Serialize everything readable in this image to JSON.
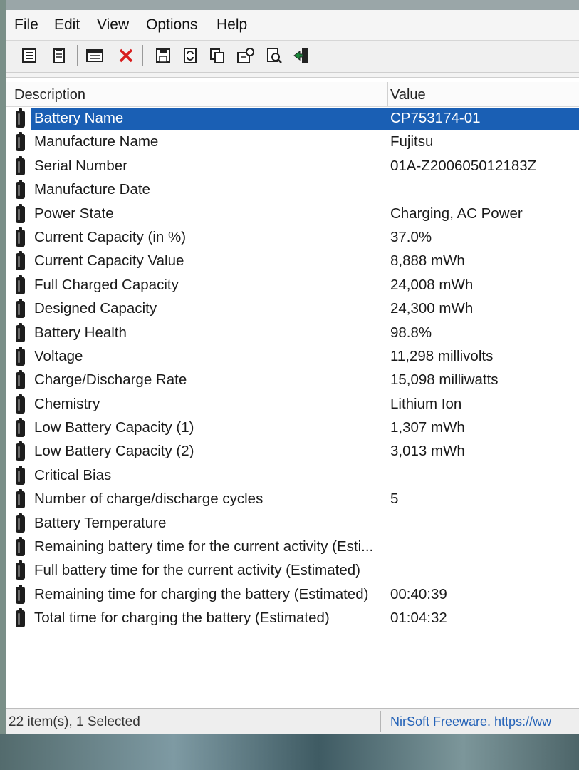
{
  "menu": [
    "File",
    "Edit",
    "View",
    "Options",
    "Help"
  ],
  "toolbar_icons": [
    "html-report-icon",
    "text-report-icon",
    "properties-icon",
    "delete-icon",
    "save-icon",
    "refresh-icon",
    "copy-icon",
    "options-icon",
    "find-icon",
    "exit-icon"
  ],
  "columns": {
    "description": "Description",
    "value": "Value"
  },
  "rows": [
    {
      "desc": "Battery Name",
      "val": "CP753174-01",
      "selected": true
    },
    {
      "desc": "Manufacture Name",
      "val": "Fujitsu"
    },
    {
      "desc": "Serial Number",
      "val": "01A-Z200605012183Z"
    },
    {
      "desc": "Manufacture Date",
      "val": ""
    },
    {
      "desc": "Power State",
      "val": "Charging, AC Power"
    },
    {
      "desc": "Current Capacity (in %)",
      "val": "37.0%"
    },
    {
      "desc": "Current Capacity Value",
      "val": "8,888 mWh"
    },
    {
      "desc": "Full Charged Capacity",
      "val": "24,008 mWh"
    },
    {
      "desc": "Designed Capacity",
      "val": "24,300 mWh"
    },
    {
      "desc": "Battery Health",
      "val": "98.8%"
    },
    {
      "desc": "Voltage",
      "val": "11,298 millivolts"
    },
    {
      "desc": "Charge/Discharge Rate",
      "val": "15,098 milliwatts"
    },
    {
      "desc": "Chemistry",
      "val": "Lithium Ion"
    },
    {
      "desc": "Low Battery Capacity (1)",
      "val": "1,307 mWh"
    },
    {
      "desc": "Low Battery Capacity (2)",
      "val": "3,013 mWh"
    },
    {
      "desc": "Critical Bias",
      "val": ""
    },
    {
      "desc": "Number of charge/discharge cycles",
      "val": "5"
    },
    {
      "desc": "Battery Temperature",
      "val": ""
    },
    {
      "desc": "Remaining battery time for the current activity (Esti...",
      "val": ""
    },
    {
      "desc": "Full battery time for the current activity (Estimated)",
      "val": ""
    },
    {
      "desc": "Remaining time for charging the battery (Estimated)",
      "val": "00:40:39"
    },
    {
      "desc": "Total time for charging the battery (Estimated)",
      "val": "01:04:32"
    }
  ],
  "status": {
    "items": "22 item(s), 1 Selected",
    "credit": "NirSoft Freeware. https://ww"
  },
  "colors": {
    "selection": "#1a5fb4",
    "link": "#2563b8"
  }
}
